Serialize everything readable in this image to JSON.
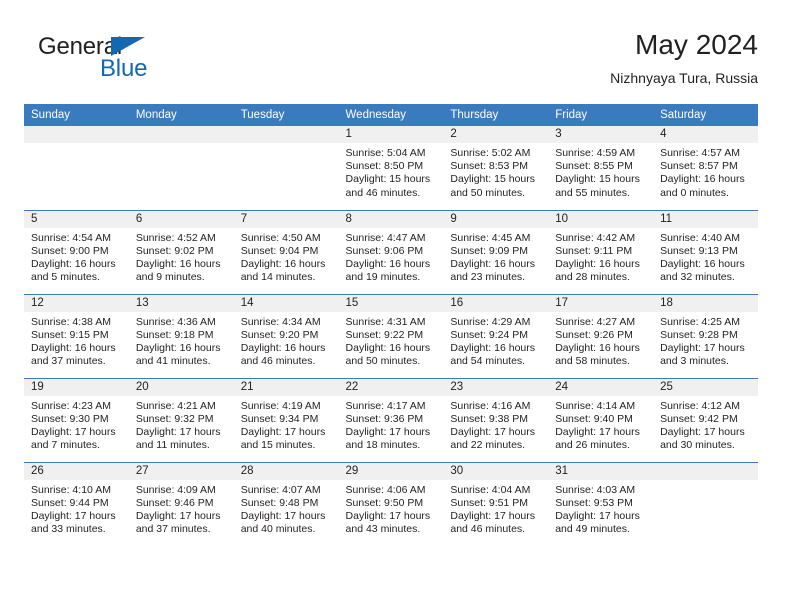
{
  "brand": {
    "name_top": "General",
    "name_bottom": "Blue",
    "accent_color": "#1268b3",
    "triangle_icon": "brand-triangle-icon"
  },
  "header": {
    "title": "May 2024",
    "subtitle": "Nizhnyaya Tura, Russia"
  },
  "theme": {
    "header_bg": "#3a7bbf",
    "daynum_bg": "#f0f0f0",
    "text": "#231f20",
    "page_bg": "#ffffff"
  },
  "weekdays": [
    "Sunday",
    "Monday",
    "Tuesday",
    "Wednesday",
    "Thursday",
    "Friday",
    "Saturday"
  ],
  "weeks": [
    [
      {
        "day": "",
        "sunrise": "",
        "sunset": "",
        "daylight1": "",
        "daylight2": ""
      },
      {
        "day": "",
        "sunrise": "",
        "sunset": "",
        "daylight1": "",
        "daylight2": ""
      },
      {
        "day": "",
        "sunrise": "",
        "sunset": "",
        "daylight1": "",
        "daylight2": ""
      },
      {
        "day": "1",
        "sunrise": "Sunrise: 5:04 AM",
        "sunset": "Sunset: 8:50 PM",
        "daylight1": "Daylight: 15 hours",
        "daylight2": "and 46 minutes."
      },
      {
        "day": "2",
        "sunrise": "Sunrise: 5:02 AM",
        "sunset": "Sunset: 8:53 PM",
        "daylight1": "Daylight: 15 hours",
        "daylight2": "and 50 minutes."
      },
      {
        "day": "3",
        "sunrise": "Sunrise: 4:59 AM",
        "sunset": "Sunset: 8:55 PM",
        "daylight1": "Daylight: 15 hours",
        "daylight2": "and 55 minutes."
      },
      {
        "day": "4",
        "sunrise": "Sunrise: 4:57 AM",
        "sunset": "Sunset: 8:57 PM",
        "daylight1": "Daylight: 16 hours",
        "daylight2": "and 0 minutes."
      }
    ],
    [
      {
        "day": "5",
        "sunrise": "Sunrise: 4:54 AM",
        "sunset": "Sunset: 9:00 PM",
        "daylight1": "Daylight: 16 hours",
        "daylight2": "and 5 minutes."
      },
      {
        "day": "6",
        "sunrise": "Sunrise: 4:52 AM",
        "sunset": "Sunset: 9:02 PM",
        "daylight1": "Daylight: 16 hours",
        "daylight2": "and 9 minutes."
      },
      {
        "day": "7",
        "sunrise": "Sunrise: 4:50 AM",
        "sunset": "Sunset: 9:04 PM",
        "daylight1": "Daylight: 16 hours",
        "daylight2": "and 14 minutes."
      },
      {
        "day": "8",
        "sunrise": "Sunrise: 4:47 AM",
        "sunset": "Sunset: 9:06 PM",
        "daylight1": "Daylight: 16 hours",
        "daylight2": "and 19 minutes."
      },
      {
        "day": "9",
        "sunrise": "Sunrise: 4:45 AM",
        "sunset": "Sunset: 9:09 PM",
        "daylight1": "Daylight: 16 hours",
        "daylight2": "and 23 minutes."
      },
      {
        "day": "10",
        "sunrise": "Sunrise: 4:42 AM",
        "sunset": "Sunset: 9:11 PM",
        "daylight1": "Daylight: 16 hours",
        "daylight2": "and 28 minutes."
      },
      {
        "day": "11",
        "sunrise": "Sunrise: 4:40 AM",
        "sunset": "Sunset: 9:13 PM",
        "daylight1": "Daylight: 16 hours",
        "daylight2": "and 32 minutes."
      }
    ],
    [
      {
        "day": "12",
        "sunrise": "Sunrise: 4:38 AM",
        "sunset": "Sunset: 9:15 PM",
        "daylight1": "Daylight: 16 hours",
        "daylight2": "and 37 minutes."
      },
      {
        "day": "13",
        "sunrise": "Sunrise: 4:36 AM",
        "sunset": "Sunset: 9:18 PM",
        "daylight1": "Daylight: 16 hours",
        "daylight2": "and 41 minutes."
      },
      {
        "day": "14",
        "sunrise": "Sunrise: 4:34 AM",
        "sunset": "Sunset: 9:20 PM",
        "daylight1": "Daylight: 16 hours",
        "daylight2": "and 46 minutes."
      },
      {
        "day": "15",
        "sunrise": "Sunrise: 4:31 AM",
        "sunset": "Sunset: 9:22 PM",
        "daylight1": "Daylight: 16 hours",
        "daylight2": "and 50 minutes."
      },
      {
        "day": "16",
        "sunrise": "Sunrise: 4:29 AM",
        "sunset": "Sunset: 9:24 PM",
        "daylight1": "Daylight: 16 hours",
        "daylight2": "and 54 minutes."
      },
      {
        "day": "17",
        "sunrise": "Sunrise: 4:27 AM",
        "sunset": "Sunset: 9:26 PM",
        "daylight1": "Daylight: 16 hours",
        "daylight2": "and 58 minutes."
      },
      {
        "day": "18",
        "sunrise": "Sunrise: 4:25 AM",
        "sunset": "Sunset: 9:28 PM",
        "daylight1": "Daylight: 17 hours",
        "daylight2": "and 3 minutes."
      }
    ],
    [
      {
        "day": "19",
        "sunrise": "Sunrise: 4:23 AM",
        "sunset": "Sunset: 9:30 PM",
        "daylight1": "Daylight: 17 hours",
        "daylight2": "and 7 minutes."
      },
      {
        "day": "20",
        "sunrise": "Sunrise: 4:21 AM",
        "sunset": "Sunset: 9:32 PM",
        "daylight1": "Daylight: 17 hours",
        "daylight2": "and 11 minutes."
      },
      {
        "day": "21",
        "sunrise": "Sunrise: 4:19 AM",
        "sunset": "Sunset: 9:34 PM",
        "daylight1": "Daylight: 17 hours",
        "daylight2": "and 15 minutes."
      },
      {
        "day": "22",
        "sunrise": "Sunrise: 4:17 AM",
        "sunset": "Sunset: 9:36 PM",
        "daylight1": "Daylight: 17 hours",
        "daylight2": "and 18 minutes."
      },
      {
        "day": "23",
        "sunrise": "Sunrise: 4:16 AM",
        "sunset": "Sunset: 9:38 PM",
        "daylight1": "Daylight: 17 hours",
        "daylight2": "and 22 minutes."
      },
      {
        "day": "24",
        "sunrise": "Sunrise: 4:14 AM",
        "sunset": "Sunset: 9:40 PM",
        "daylight1": "Daylight: 17 hours",
        "daylight2": "and 26 minutes."
      },
      {
        "day": "25",
        "sunrise": "Sunrise: 4:12 AM",
        "sunset": "Sunset: 9:42 PM",
        "daylight1": "Daylight: 17 hours",
        "daylight2": "and 30 minutes."
      }
    ],
    [
      {
        "day": "26",
        "sunrise": "Sunrise: 4:10 AM",
        "sunset": "Sunset: 9:44 PM",
        "daylight1": "Daylight: 17 hours",
        "daylight2": "and 33 minutes."
      },
      {
        "day": "27",
        "sunrise": "Sunrise: 4:09 AM",
        "sunset": "Sunset: 9:46 PM",
        "daylight1": "Daylight: 17 hours",
        "daylight2": "and 37 minutes."
      },
      {
        "day": "28",
        "sunrise": "Sunrise: 4:07 AM",
        "sunset": "Sunset: 9:48 PM",
        "daylight1": "Daylight: 17 hours",
        "daylight2": "and 40 minutes."
      },
      {
        "day": "29",
        "sunrise": "Sunrise: 4:06 AM",
        "sunset": "Sunset: 9:50 PM",
        "daylight1": "Daylight: 17 hours",
        "daylight2": "and 43 minutes."
      },
      {
        "day": "30",
        "sunrise": "Sunrise: 4:04 AM",
        "sunset": "Sunset: 9:51 PM",
        "daylight1": "Daylight: 17 hours",
        "daylight2": "and 46 minutes."
      },
      {
        "day": "31",
        "sunrise": "Sunrise: 4:03 AM",
        "sunset": "Sunset: 9:53 PM",
        "daylight1": "Daylight: 17 hours",
        "daylight2": "and 49 minutes."
      },
      {
        "day": "",
        "sunrise": "",
        "sunset": "",
        "daylight1": "",
        "daylight2": ""
      }
    ]
  ]
}
